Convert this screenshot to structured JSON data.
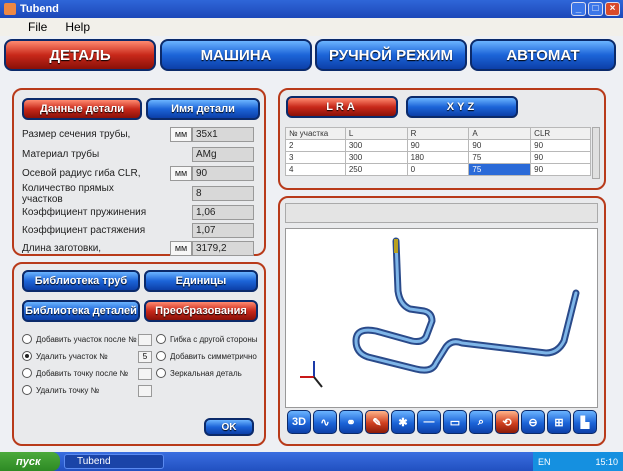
{
  "window": {
    "title": "Tubend"
  },
  "menu": {
    "file": "File",
    "help": "Help"
  },
  "nav": {
    "detail": "ДЕТАЛЬ",
    "machine": "МАШИНА",
    "manual": "РУЧНОЙ РЕЖИМ",
    "auto": "АВТОМАТ"
  },
  "left_top": {
    "tab_data": "Данные детали",
    "tab_name": "Имя детали",
    "rows": [
      {
        "label": "Размер сечения трубы,",
        "unit": "мм",
        "value": "35x1"
      },
      {
        "label": "Материал трубы",
        "unit": "",
        "value": "AMg"
      },
      {
        "label": "Осевой радиус гиба CLR,",
        "unit": "мм",
        "value": "90"
      },
      {
        "label": "Количество прямых участков",
        "unit": "",
        "value": "8"
      },
      {
        "label": "Коэффициент пружинения",
        "unit": "",
        "value": "1,06"
      },
      {
        "label": "Коэффициент растяжения",
        "unit": "",
        "value": "1,07"
      },
      {
        "label": "Длина заготовки,",
        "unit": "мм",
        "value": "3179,2"
      }
    ]
  },
  "left_bottom": {
    "btn_tubes": "Библиотека труб",
    "btn_units": "Единицы",
    "btn_parts": "Библиотека деталей",
    "btn_transform": "Преобразования",
    "options_left": [
      {
        "label": "Добавить участок после №",
        "value": ""
      },
      {
        "label": "Удалить участок №",
        "value": "5"
      },
      {
        "label": "Добавить точку после №",
        "value": ""
      },
      {
        "label": "Удалить точку №",
        "value": ""
      }
    ],
    "options_right": [
      "Гибка с другой стороны",
      "Добавить симметрично",
      "Зеркальная деталь"
    ],
    "ok": "OK"
  },
  "right_top": {
    "tab_lra": "LRA",
    "tab_xyz": "XYZ",
    "headers": [
      "№ участка",
      "L",
      "R",
      "A",
      "CLR"
    ],
    "rows": [
      [
        "2",
        "300",
        "90",
        "90",
        "90"
      ],
      [
        "3",
        "300",
        "180",
        "75",
        "90"
      ],
      [
        "4",
        "250",
        "0",
        "75",
        "90"
      ]
    ]
  },
  "toolbar": {
    "btn_3d": "3D"
  },
  "taskbar": {
    "start": "пуск",
    "task": "Tubend",
    "lang": "EN",
    "time": "15:10"
  }
}
